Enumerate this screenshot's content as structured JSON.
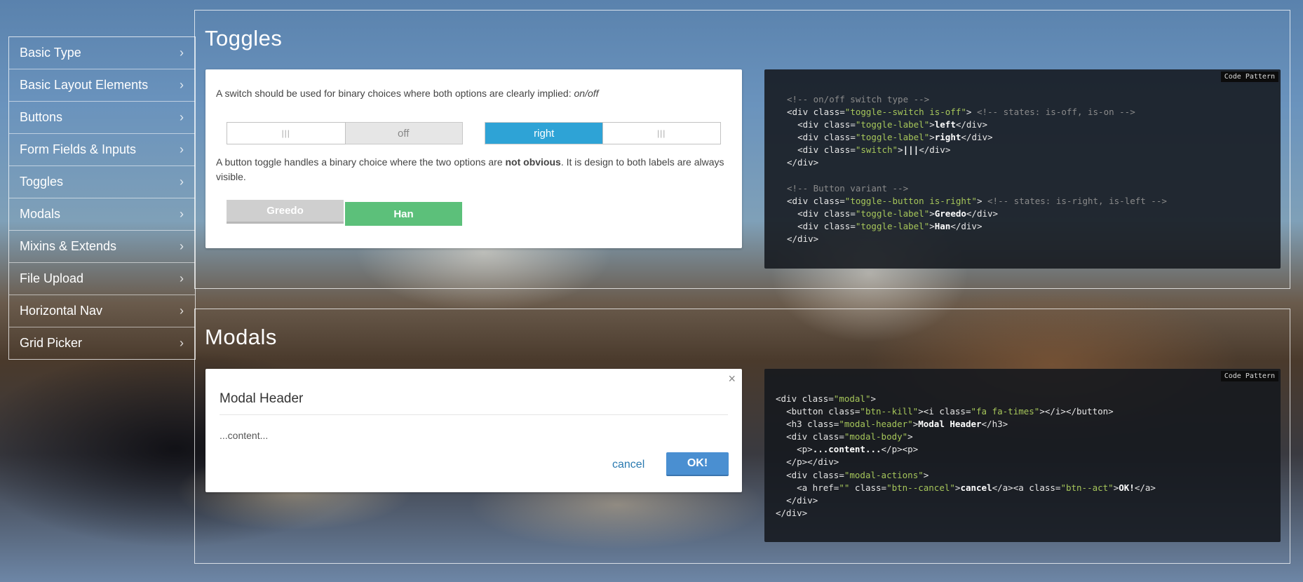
{
  "sidebar": {
    "items": [
      {
        "label": "Basic Type"
      },
      {
        "label": "Basic Layout Elements"
      },
      {
        "label": "Buttons"
      },
      {
        "label": "Form Fields & Inputs"
      },
      {
        "label": "Toggles"
      },
      {
        "label": "Modals"
      },
      {
        "label": "Mixins & Extends"
      },
      {
        "label": "File Upload"
      },
      {
        "label": "Horizontal Nav"
      },
      {
        "label": "Grid Picker"
      }
    ],
    "chevron": "›"
  },
  "toggles": {
    "title": "Toggles",
    "desc1": "A switch should be used for binary choices where both options are clearly implied: ",
    "desc1_em": "on/off",
    "switch1": {
      "handle": "|||",
      "label": "off"
    },
    "switch2": {
      "label": "right",
      "handle": "|||"
    },
    "desc2_a": "A button toggle handles a binary choice where the two options are ",
    "desc2_b": "not obvious",
    "desc2_c": ". It is design to both labels are always visible.",
    "btn_left": "Greedo",
    "btn_right": "Han",
    "code_tag": "Code Pattern"
  },
  "modals": {
    "title": "Modals",
    "close_icon": "×",
    "header": "Modal Header",
    "body": "...content...",
    "cancel": "cancel",
    "ok": "OK!",
    "code_tag": "Code Pattern"
  },
  "colors": {
    "switch_on": "#2ea3d6",
    "toggle_active": "#5cc07a",
    "toggle_inactive": "#cfcfcf",
    "ok_button": "#4a8fd1",
    "code_string": "#a6c65a"
  }
}
